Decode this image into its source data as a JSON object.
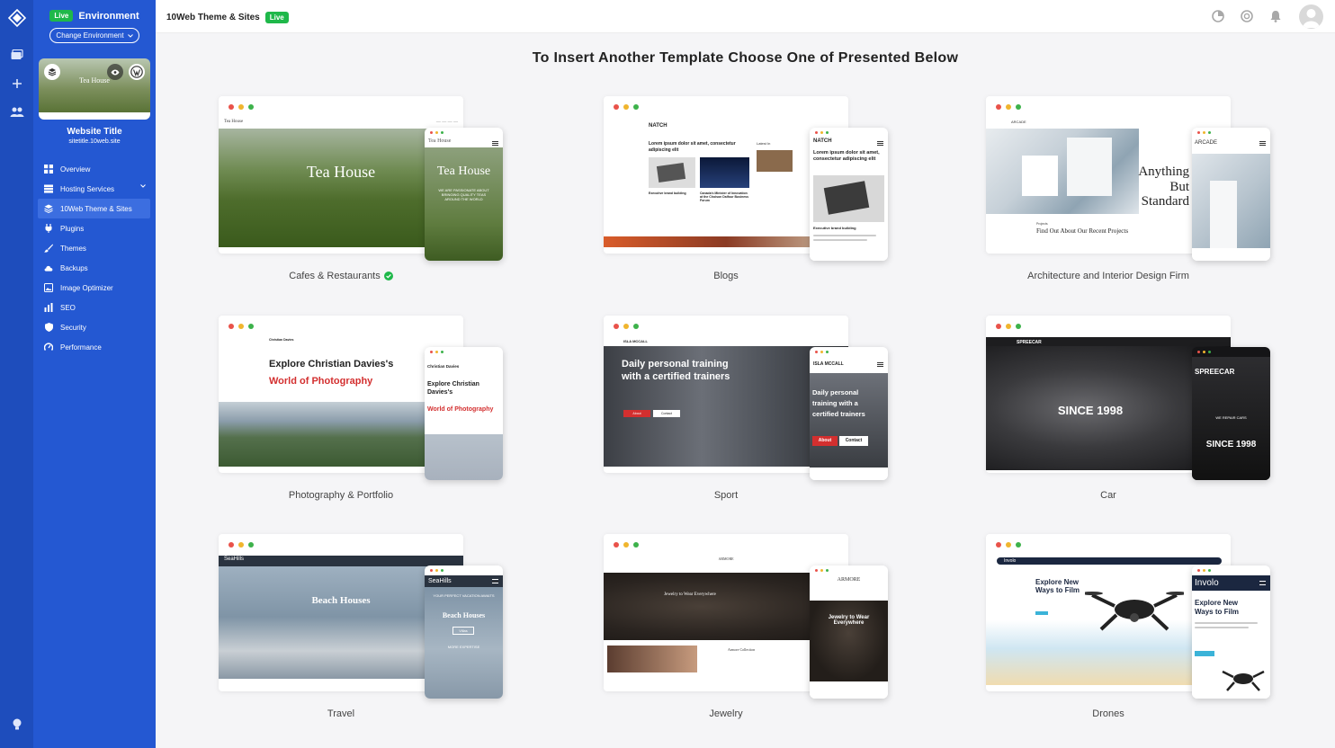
{
  "sidebar": {
    "env_badge": "Live",
    "env_label": "Environment",
    "change_env": "Change Environment",
    "site_thumb_text": "Tea House",
    "site_title": "Website Title",
    "site_url": "sitetitle.10web.site",
    "items": [
      {
        "label": "Overview",
        "icon": "grid-icon"
      },
      {
        "label": "Hosting Services",
        "icon": "server-icon"
      },
      {
        "label": "10Web Theme & Sites",
        "icon": "layers-icon",
        "active": true
      },
      {
        "label": "Plugins",
        "icon": "plug-icon"
      },
      {
        "label": "Themes",
        "icon": "brush-icon"
      },
      {
        "label": "Backups",
        "icon": "cloud-icon"
      },
      {
        "label": "Image Optimizer",
        "icon": "image-icon"
      },
      {
        "label": "SEO",
        "icon": "bar-chart-icon"
      },
      {
        "label": "Security",
        "icon": "shield-icon"
      },
      {
        "label": "Performance",
        "icon": "gauge-icon"
      }
    ]
  },
  "topbar": {
    "title": "10Web Theme & Sites",
    "badge": "Live"
  },
  "main": {
    "heading": "To Insert Another Template Choose One of Presented Below"
  },
  "templates": [
    {
      "label": "Cafes & Restaurants",
      "verified": true,
      "hero_text": "Tea House",
      "brand": "Tea House",
      "phone_sub": "WE ARE PASSIONATE ABOUT BRINGING QUALITY TEAS AROUND THE WORLD"
    },
    {
      "label": "Blogs",
      "brand": "NATCH",
      "headline": "Lorem ipsum dolor sit amet, consectetur adipiscing elit",
      "latest": "Latest In",
      "caption": "Executive brand building",
      "caption2": "Canada's Minister of Innovation at the Choison Dalfour Business Forum"
    },
    {
      "label": "Architecture and Interior Design Firm",
      "brand": "ARCADE",
      "headline": "Anything But Standard",
      "section": "Projects",
      "sub": "Find Out About Our Recent Projects"
    },
    {
      "label": "Photography & Portfolio",
      "brand": "Christian Davies",
      "line1": "Explore Christian Davies's",
      "line2": "World of Photography",
      "phone_line1": "Explore Christian Davies's",
      "phone_line2": "World of Photography"
    },
    {
      "label": "Sport",
      "brand": "ISLA MCCALL",
      "headline": "Daily personal training with a certified trainers",
      "btn1": "About",
      "btn2": "Contact"
    },
    {
      "label": "Car",
      "brand": "SPREECAR",
      "headline": "SINCE 1998",
      "sub": "WE REPAIR CARS"
    },
    {
      "label": "Travel",
      "brand": "SeaHills",
      "headline": "Beach Houses",
      "sub": "YOUR PERFECT VACATION AWAITS",
      "btn": "Villas",
      "more": "MORE EXPERTISE"
    },
    {
      "label": "Jewelry",
      "brand": "ARMORE",
      "headline": "Jewelry to Wear Everywhere",
      "section": "Armore Collection"
    },
    {
      "label": "Drones",
      "brand": "Involo",
      "headline": "Explore New Ways to Film"
    }
  ]
}
